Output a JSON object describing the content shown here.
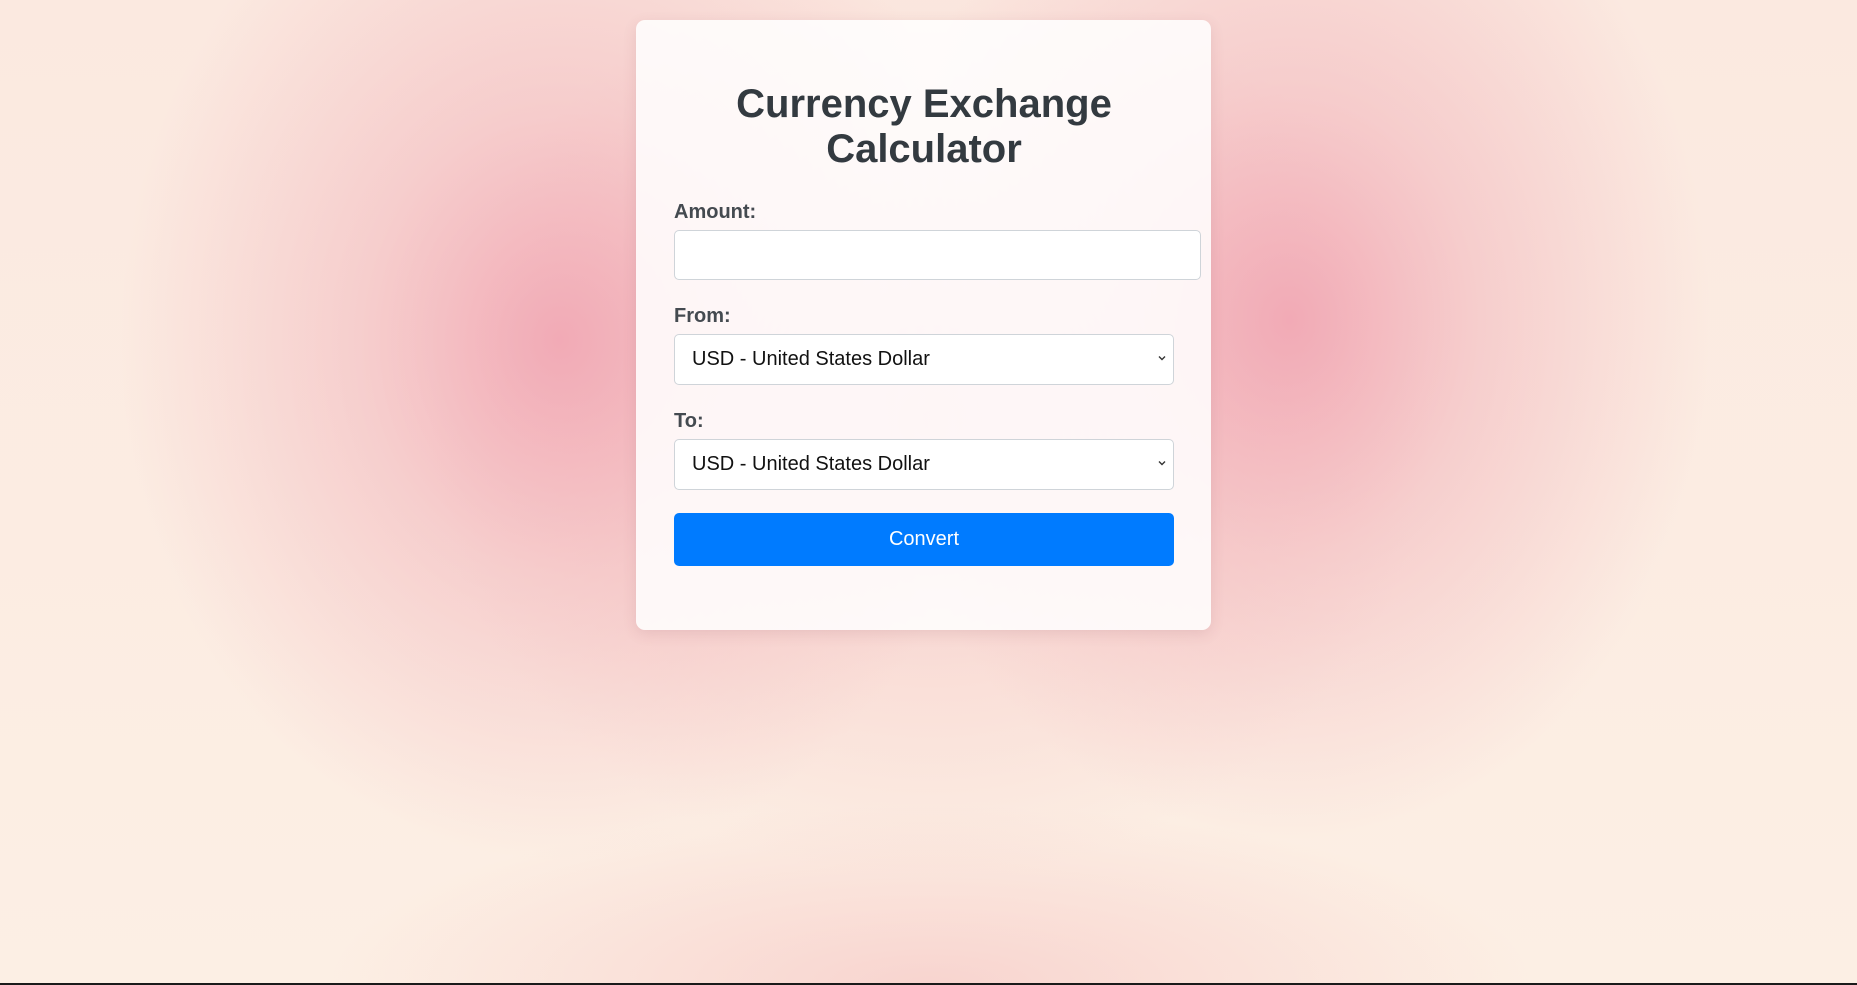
{
  "page": {
    "title": "Currency Exchange Calculator"
  },
  "form": {
    "amount": {
      "label": "Amount:",
      "value": "",
      "placeholder": ""
    },
    "from": {
      "label": "From:",
      "selected": "USD - United States Dollar"
    },
    "to": {
      "label": "To:",
      "selected": "USD - United States Dollar"
    },
    "convert_label": "Convert"
  },
  "colors": {
    "accent": "#007bff",
    "title_text": "#333a40",
    "label_text": "#444a50"
  },
  "icons": {
    "select_arrow": "chevron-down-icon"
  }
}
